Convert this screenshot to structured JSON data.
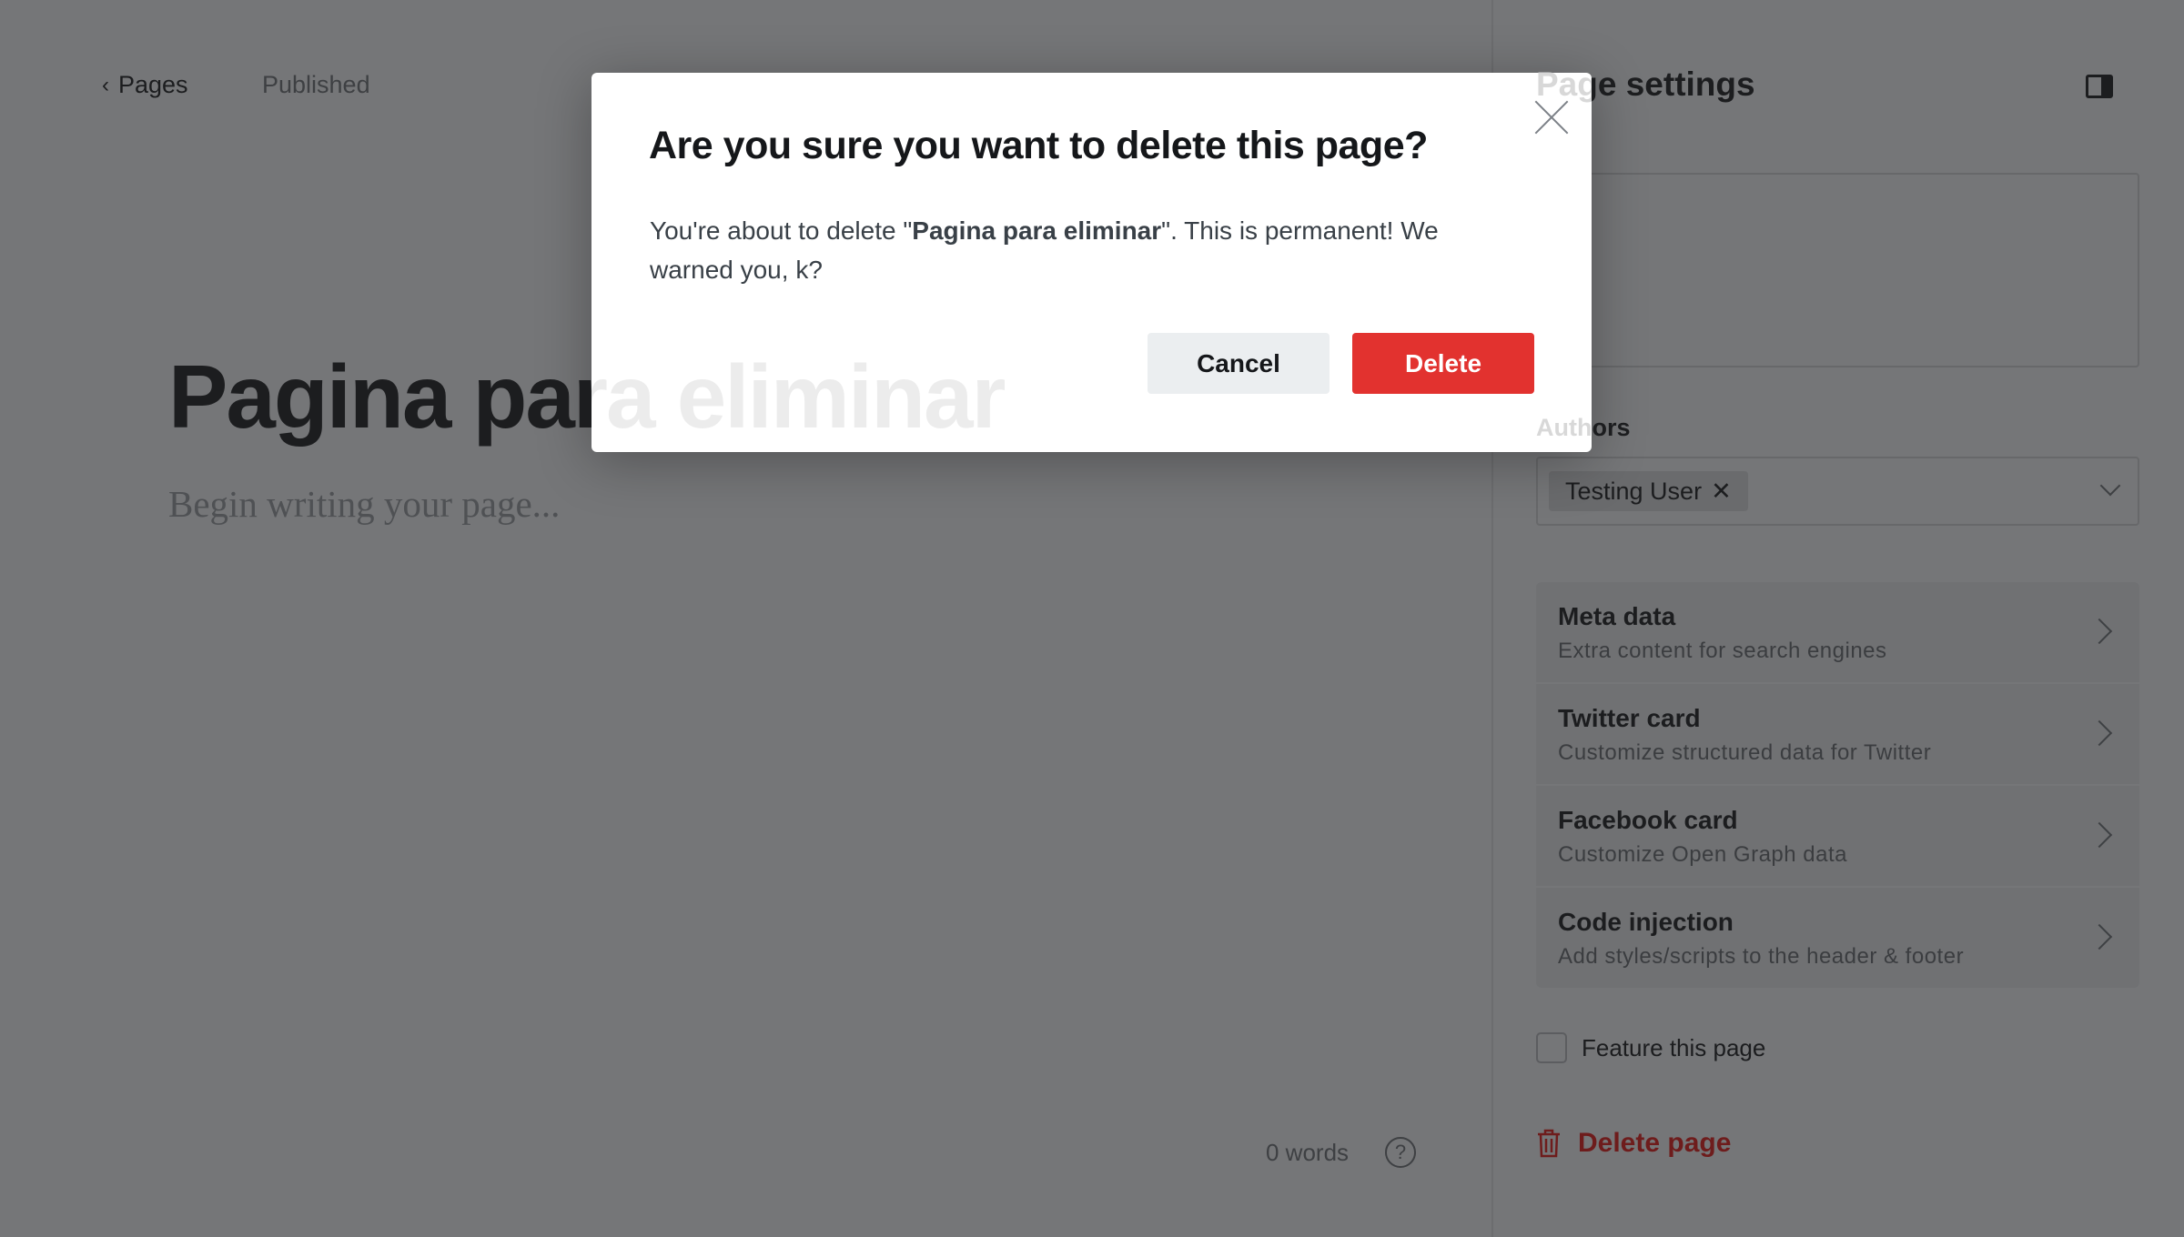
{
  "nav": {
    "back_label": "Pages",
    "status": "Published"
  },
  "editor": {
    "title": "Pagina para eliminar",
    "placeholder": "Begin writing your page...",
    "word_count": "0 words",
    "help": "?"
  },
  "settings": {
    "title": "Page settings",
    "authors_label": "Authors",
    "author_chip": "Testing User",
    "chip_remove": "✕",
    "menu": [
      {
        "title": "Meta data",
        "subtitle": "Extra content for search engines"
      },
      {
        "title": "Twitter card",
        "subtitle": "Customize structured data for Twitter"
      },
      {
        "title": "Facebook card",
        "subtitle": "Customize Open Graph data"
      },
      {
        "title": "Code injection",
        "subtitle": "Add styles/scripts to the header & footer"
      }
    ],
    "feature_label": "Feature this page",
    "feature_checked": false,
    "delete_label": "Delete page"
  },
  "modal": {
    "title": "Are you sure you want to delete this page?",
    "body_prefix": "You're about to delete \"",
    "body_bold": "Pagina para eliminar",
    "body_suffix": "\". This is permanent! We warned you, k?",
    "cancel": "Cancel",
    "delete": "Delete"
  },
  "colors": {
    "danger": "#e2322f"
  }
}
